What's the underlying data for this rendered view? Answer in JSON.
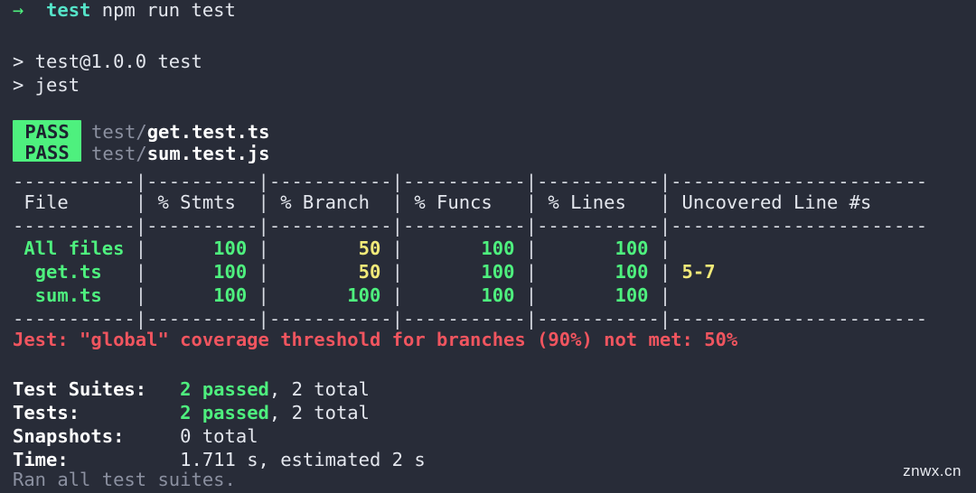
{
  "terminal": {
    "background_color": "#282c38",
    "foreground_color": "#d8dbe3",
    "clipped_top_line": "",
    "prompt": {
      "arrow": "→",
      "cwd": "test",
      "command": "npm run test"
    },
    "npm_lines": [
      "> test@1.0.0 test",
      "> jest"
    ],
    "pass_results": [
      {
        "badge": "PASS",
        "dir": "test/",
        "file": "get.test.ts"
      },
      {
        "badge": "PASS",
        "dir": "test/",
        "file": "sum.test.js"
      }
    ],
    "coverage_table": {
      "rule_left": "----------|",
      "headers": [
        "File",
        "% Stmts",
        "% Branch",
        "% Funcs",
        "% Lines",
        "Uncovered Line #s"
      ],
      "rows": [
        {
          "file": "All files",
          "indent": 0,
          "stmts": "100",
          "stmts_color": "green",
          "branch": "50",
          "branch_color": "yellow",
          "funcs": "100",
          "funcs_color": "green",
          "lines": "100",
          "lines_color": "green",
          "uncovered": "",
          "uncovered_color": "yellow"
        },
        {
          "file": "get.ts",
          "indent": 1,
          "stmts": "100",
          "stmts_color": "green",
          "branch": "50",
          "branch_color": "yellow",
          "funcs": "100",
          "funcs_color": "green",
          "lines": "100",
          "lines_color": "green",
          "uncovered": "5-7",
          "uncovered_color": "yellow"
        },
        {
          "file": "sum.ts",
          "indent": 1,
          "stmts": "100",
          "stmts_color": "green",
          "branch": "100",
          "branch_color": "green",
          "funcs": "100",
          "funcs_color": "green",
          "lines": "100",
          "lines_color": "green",
          "uncovered": "",
          "uncovered_color": "yellow"
        }
      ]
    },
    "threshold_error": "Jest: \"global\" coverage threshold for branches (90%) not met: 50%",
    "summary": [
      {
        "label": "Test Suites:",
        "highlight": "2 passed",
        "rest": ", 2 total"
      },
      {
        "label": "Tests:",
        "highlight": "2 passed",
        "rest": ", 2 total"
      },
      {
        "label": "Snapshots:",
        "highlight": "",
        "rest": "0 total"
      },
      {
        "label": "Time:",
        "highlight": "",
        "rest": "1.711 s, estimated 2 s"
      }
    ],
    "footer": "Ran all test suites.",
    "watermark": "znwx.cn",
    "colors": {
      "pass_badge_bg": "#4ef07e",
      "pass_badge_fg": "#1d2230",
      "green": "#4ef07e",
      "cyan": "#55e3c8",
      "yellow": "#f2ea79",
      "red": "#f0555f",
      "dim": "#8b90a0"
    }
  }
}
